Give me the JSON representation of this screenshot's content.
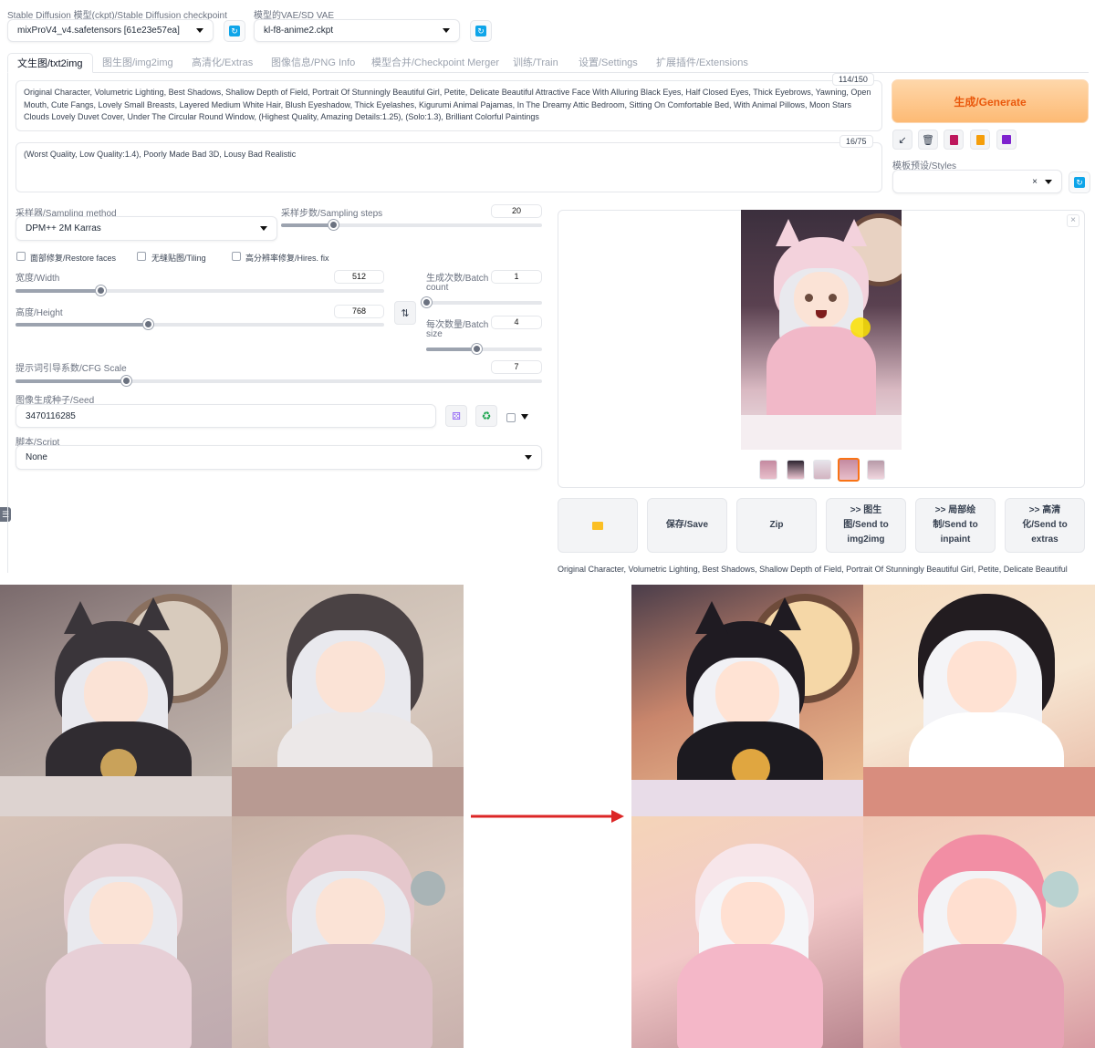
{
  "checkpoint": {
    "label": "Stable Diffusion 模型(ckpt)/Stable Diffusion checkpoint",
    "value": "mixProV4_v4.safetensors [61e23e57ea]"
  },
  "vae": {
    "label": "模型的VAE/SD VAE",
    "value": "kl-f8-anime2.ckpt"
  },
  "tabs": [
    "文生图/txt2img",
    "图生图/img2img",
    "高清化/Extras",
    "图像信息/PNG Info",
    "模型合并/Checkpoint Merger",
    "训练/Train",
    "设置/Settings",
    "扩展插件/Extensions"
  ],
  "prompt": {
    "text": "Original Character, Volumetric Lighting, Best Shadows, Shallow Depth of Field, Portrait Of Stunningly Beautiful Girl, Petite, Delicate Beautiful Attractive Face With Alluring Black Eyes, Half Closed Eyes, Thick Eyebrows, Yawning, Open Mouth, Cute Fangs, Lovely Small Breasts, Layered Medium White Hair, Blush Eyeshadow, Thick Eyelashes, Kigurumi Animal Pajamas, In The Dreamy Attic Bedroom, Sitting On Comfortable Bed, With Animal Pillows, Moon Stars Clouds Lovely Duvet Cover, Under The Circular Round Window, (Highest Quality, Amazing Details:1.25), (Solo:1.3), Brilliant Colorful Paintings",
    "counter": "114/150"
  },
  "negative": {
    "text": "(Worst Quality, Low Quality:1.4), Poorly Made Bad 3D, Lousy Bad Realistic",
    "counter": "16/75"
  },
  "generate_label": "生成/Generate",
  "styles_label": "模板预设/Styles",
  "sampling": {
    "method_label": "采样器/Sampling method",
    "method_value": "DPM++ 2M Karras",
    "steps_label": "采样步数/Sampling steps",
    "steps_value": "20",
    "steps_fraction": 0.2
  },
  "checkboxes": [
    "面部修复/Restore faces",
    "无缝贴图/Tiling",
    "高分辨率修复/Hires. fix"
  ],
  "width": {
    "label": "宽度/Width",
    "value": "512",
    "fraction": 0.23
  },
  "height": {
    "label": "高度/Height",
    "value": "768",
    "fraction": 0.36
  },
  "batch_count": {
    "label1": "生成次数/Batch",
    "label2": "count",
    "value": "1",
    "fraction": 0.0
  },
  "batch_size": {
    "label1": "每次数量/Batch",
    "label2": "size",
    "value": "4",
    "fraction": 0.43
  },
  "cfg": {
    "label": "提示词引导系数/CFG Scale",
    "value": "7",
    "fraction": 0.21
  },
  "seed": {
    "label": "图像生成种子/Seed",
    "value": "3470116285"
  },
  "script": {
    "label": "脚本/Script",
    "value": "None"
  },
  "actions": {
    "save": "保存/Save",
    "zip": "Zip",
    "img2img_1": ">> 图生",
    "img2img_2": "图/Send to",
    "img2img_3": "img2img",
    "inpaint_1": ">> 局部绘",
    "inpaint_2": "制/Send to",
    "inpaint_3": "inpaint",
    "extras_1": ">> 高清",
    "extras_2": "化/Send to",
    "extras_3": "extras"
  },
  "info_text": "Original Character, Volumetric Lighting, Best Shadows, Shallow Depth of Field, Portrait Of Stunningly Beautiful Girl, Petite, Delicate Beautiful",
  "colors": {
    "accent": "#f97316",
    "generate_bg": "#fdba74",
    "refresh": "#0ea5e9",
    "arrow": "#dc2626"
  },
  "icons": [
    "refresh-icon",
    "arrow-icon",
    "trash-icon",
    "bookmark-icon",
    "clipboard-icon",
    "save-icon",
    "swap-icon",
    "dice-icon",
    "recycle-icon",
    "folder-icon",
    "close-icon"
  ]
}
